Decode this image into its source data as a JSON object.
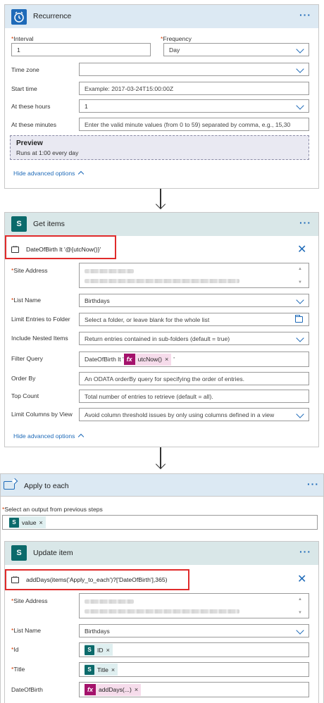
{
  "recurrence": {
    "title": "Recurrence",
    "interval_label": "Interval",
    "interval_value": "1",
    "frequency_label": "Frequency",
    "frequency_value": "Day",
    "timezone_label": "Time zone",
    "timezone_value": "",
    "start_time_label": "Start time",
    "start_time_placeholder": "Example: 2017-03-24T15:00:00Z",
    "hours_label": "At these hours",
    "hours_value": "1",
    "minutes_label": "At these minutes",
    "minutes_placeholder": "Enter the valid minute values (from 0 to 59) separated by comma, e.g., 15,30",
    "preview_title": "Preview",
    "preview_text": "Runs at 1:00 every day",
    "hide_advanced": "Hide advanced options"
  },
  "get_items": {
    "title": "Get items",
    "icon_letter": "S",
    "note": "DateOfBirth lt '@{utcNow()}'",
    "site_address_label": "Site Address",
    "list_name_label": "List Name",
    "list_name_value": "Birthdays",
    "limit_folder_label": "Limit Entries to Folder",
    "limit_folder_placeholder": "Select a folder, or leave blank for the whole list",
    "nested_label": "Include Nested Items",
    "nested_placeholder": "Return entries contained in sub-folders (default = true)",
    "filter_label": "Filter Query",
    "filter_prefix": "DateOfBirth lt '",
    "filter_token": "utcNow()",
    "filter_suffix": "'",
    "order_label": "Order By",
    "order_placeholder": "An ODATA orderBy query for specifying the order of entries.",
    "top_label": "Top Count",
    "top_placeholder": "Total number of entries to retrieve (default = all).",
    "limit_columns_label": "Limit Columns by View",
    "limit_columns_placeholder": "Avoid column threshold issues by only using columns defined in a view",
    "hide_advanced": "Hide advanced options"
  },
  "apply_each": {
    "title": "Apply to each",
    "select_label": "Select an output from previous steps",
    "token": "value"
  },
  "update_item": {
    "title": "Update item",
    "icon_letter": "S",
    "note": "addDays(items('Apply_to_each')?['DateOfBirth'],365)",
    "site_address_label": "Site Address",
    "list_name_label": "List Name",
    "list_name_value": "Birthdays",
    "id_label": "Id",
    "id_token": "ID",
    "title_label": "Title",
    "title_token": "Title",
    "dob_label": "DateOfBirth",
    "dob_token": "addDays(...)"
  },
  "symbols": {
    "required": "*",
    "remove": "×",
    "more": "···",
    "fx": "fx",
    "close": "✕"
  },
  "colors": {
    "accent": "#1e6ab8",
    "sharepoint": "#0b6a6b",
    "function": "#a4126b",
    "highlight": "#e02b2b",
    "header_bg": "#dce9f3",
    "header_teal_bg": "#d9e7e8"
  },
  "icons": {
    "recurrence": "alarm-clock-icon",
    "sharepoint": "sharepoint-icon",
    "apply_each": "loop-icon",
    "comment": "comment-icon",
    "folder": "folder-icon"
  }
}
